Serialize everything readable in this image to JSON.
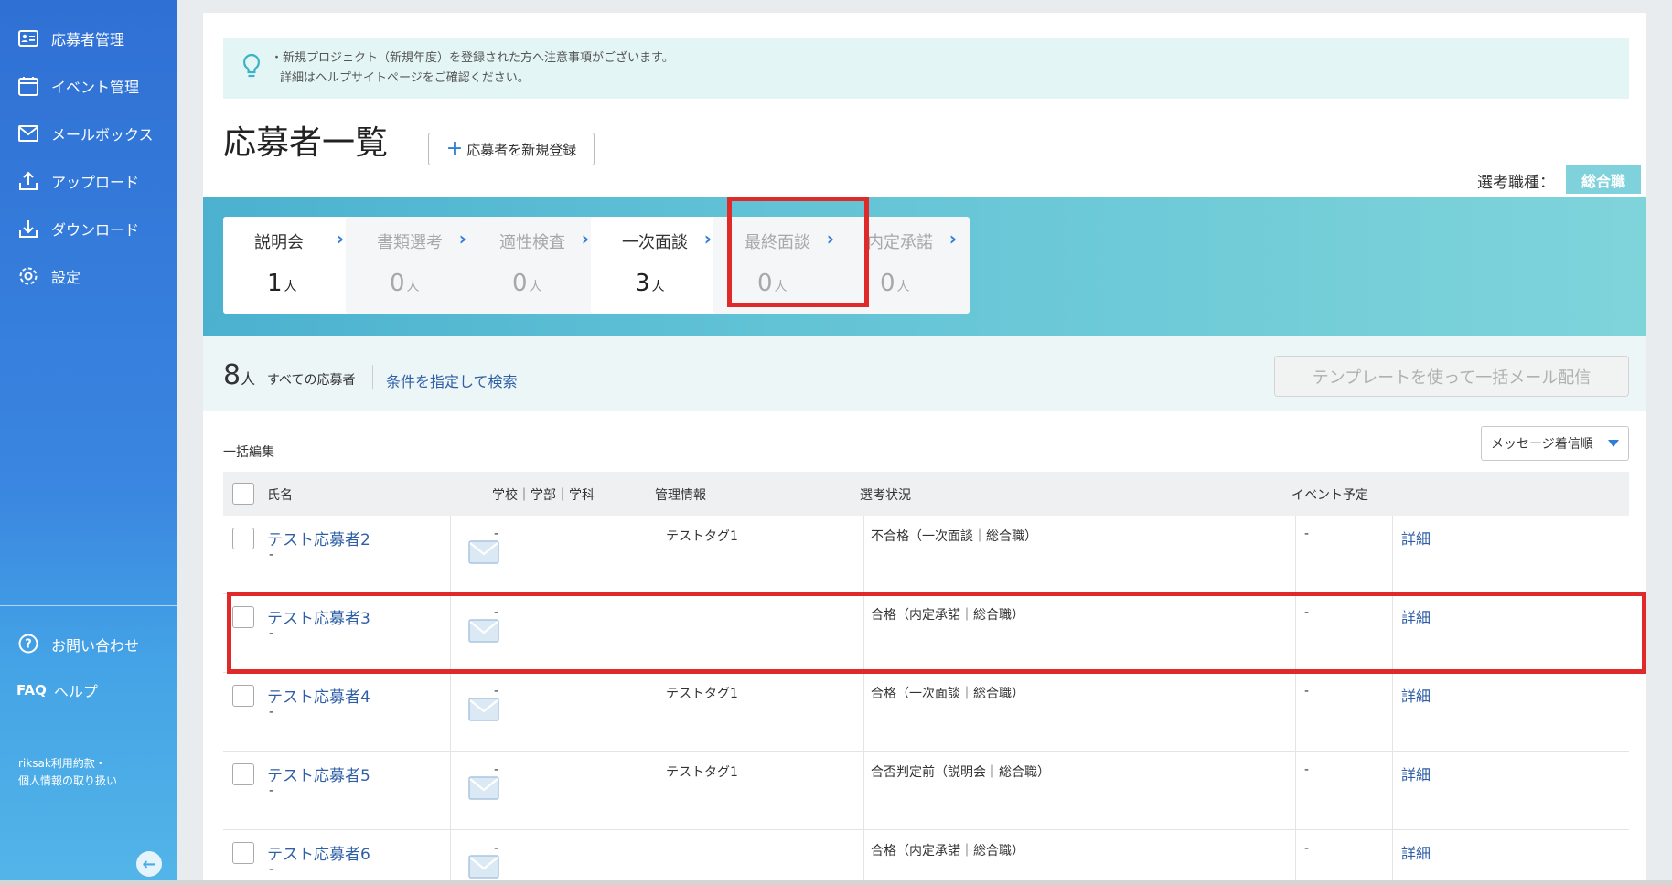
{
  "sidebar": {
    "items": [
      {
        "label": "応募者管理",
        "icon": "id-card-icon"
      },
      {
        "label": "イベント管理",
        "icon": "calendar-icon"
      },
      {
        "label": "メールボックス",
        "icon": "mail-icon"
      },
      {
        "label": "アップロード",
        "icon": "upload-icon"
      },
      {
        "label": "ダウンロード",
        "icon": "download-icon"
      },
      {
        "label": "設定",
        "icon": "gear-icon"
      }
    ],
    "contact_label": "お問い合わせ",
    "faq_tag": "FAQ",
    "help_label": "ヘルプ",
    "terms_line1": "riksak利用約款・",
    "terms_line2": "個人情報の取り扱い"
  },
  "notice": {
    "line1": "・新規プロジェクト（新規年度）を登録された方へ注意事項がございます。",
    "line2": "詳細はヘルプサイトページをご確認ください。"
  },
  "page": {
    "title": "応募者一覧",
    "add_button": "応募者を新規登録",
    "job_label": "選考職種：",
    "job_value": "総合職"
  },
  "stages": [
    {
      "name": "説明会",
      "count": "1",
      "unit": "人",
      "active": true
    },
    {
      "name": "書類選考",
      "count": "0",
      "unit": "人",
      "active": false
    },
    {
      "name": "適性検査",
      "count": "0",
      "unit": "人",
      "active": false
    },
    {
      "name": "一次面談",
      "count": "3",
      "unit": "人",
      "active": true
    },
    {
      "name": "最終面談",
      "count": "0",
      "unit": "人",
      "active": false
    },
    {
      "name": "内定承諾",
      "count": "0",
      "unit": "人",
      "active": false
    }
  ],
  "summary": {
    "count": "8",
    "unit": "人",
    "all_label": "すべての応募者",
    "search_link": "条件を指定して検索",
    "template_button": "テンプレートを使って一括メール配信"
  },
  "table": {
    "bulk_edit": "一括編集",
    "sort_label": "メッセージ着信順",
    "headers": {
      "name": "氏名",
      "school": "学校｜学部｜学科",
      "management": "管理情報",
      "status": "選考状況",
      "event": "イベント予定"
    },
    "detail_label": "詳細",
    "rows": [
      {
        "name": "テスト応募者2",
        "sub": "-",
        "school": "-",
        "tag": "テストタグ1",
        "status": "不合格（一次面談｜総合職）",
        "event": "-"
      },
      {
        "name": "テスト応募者3",
        "sub": "-",
        "school": "-",
        "tag": "",
        "status": "合格（内定承諾｜総合職）",
        "event": "-"
      },
      {
        "name": "テスト応募者4",
        "sub": "-",
        "school": "-",
        "tag": "テストタグ1",
        "status": "合格（一次面談｜総合職）",
        "event": "-"
      },
      {
        "name": "テスト応募者5",
        "sub": "-",
        "school": "-",
        "tag": "テストタグ1",
        "status": "合否判定前（説明会｜総合職）",
        "event": "-"
      },
      {
        "name": "テスト応募者6",
        "sub": "-",
        "school": "-",
        "tag": "",
        "status": "合格（内定承諾｜総合職）",
        "event": "-"
      }
    ]
  }
}
